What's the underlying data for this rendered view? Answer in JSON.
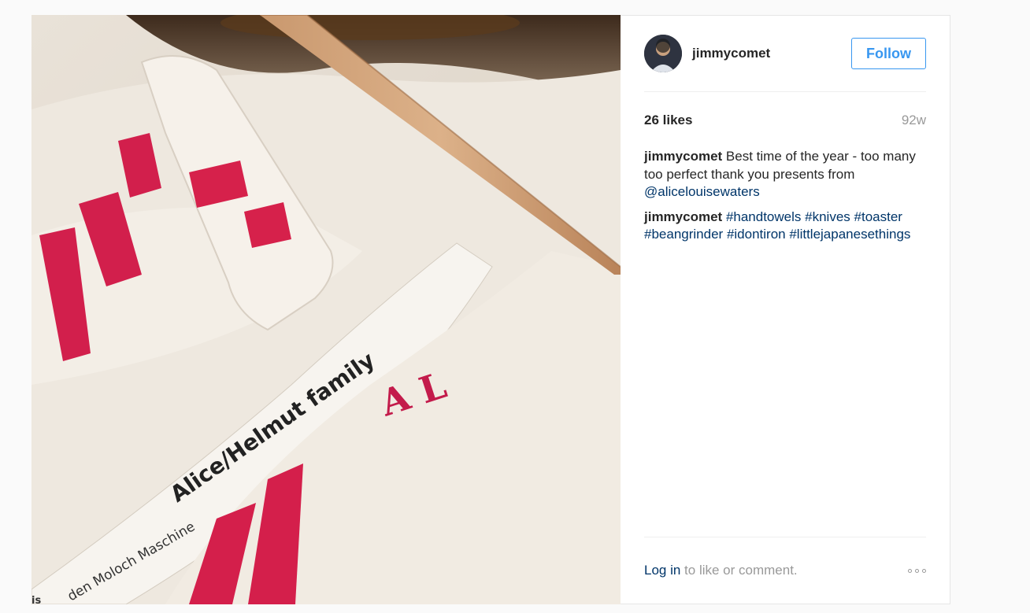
{
  "post": {
    "username": "jimmycomet",
    "follow_label": "Follow",
    "likes": "26 likes",
    "age": "92w",
    "caption": {
      "author": "jimmycomet",
      "text": " Best time of the year - too many too perfect thank you presents from ",
      "mention": "@alicelouisewaters"
    },
    "hashtag_comment": {
      "author": "jimmycomet",
      "tags": [
        "#handtowels",
        "#knives",
        "#toaster",
        "#beangrinder",
        "#idontiron",
        "#littlejapanesethings"
      ]
    },
    "footer": {
      "login_label": "Log in",
      "rest": " to like or comment."
    },
    "photo_text": {
      "print_line": "den Moloch Maschine",
      "side_letters": "is",
      "monogram": "A L",
      "handwriting": "Alice/Helmut family"
    }
  },
  "colors": {
    "link": "#003569",
    "accent": "#3897f0",
    "muted": "#999999"
  }
}
